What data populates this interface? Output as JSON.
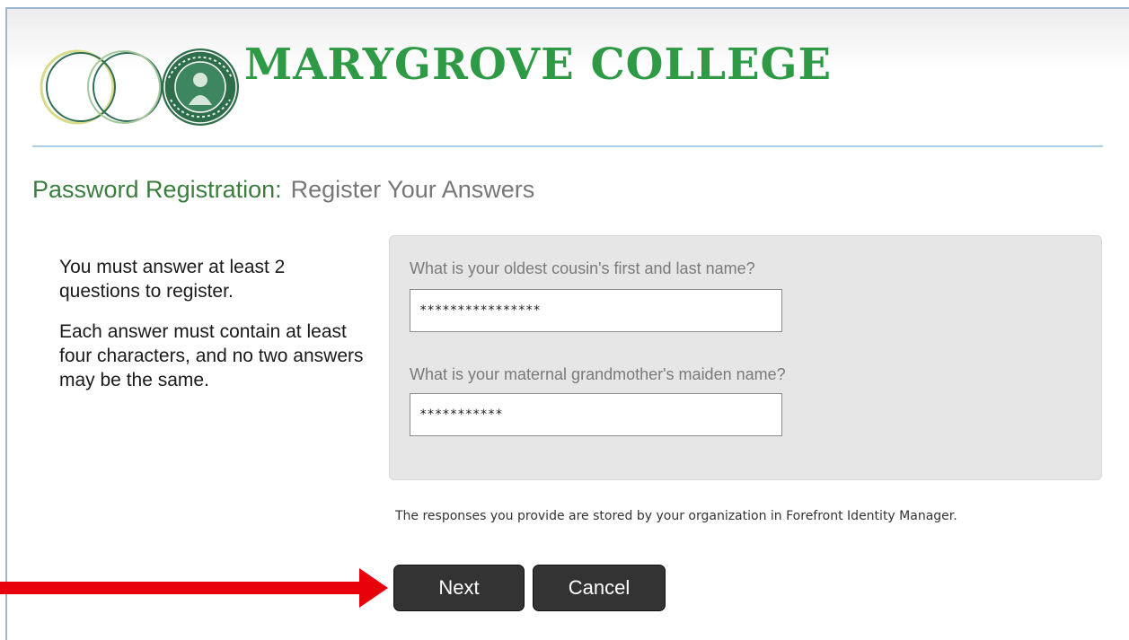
{
  "header": {
    "college_name": "MARYGROVE COLLEGE"
  },
  "page": {
    "title_main": "Password Registration:",
    "title_sub": "Register Your Answers"
  },
  "instructions": {
    "line1": "You must answer at least 2 questions to register.",
    "line2": "Each answer must contain at least four characters, and no two answers may be the same."
  },
  "questions": [
    {
      "label": "What is your oldest cousin's first and last name?",
      "value": "****************"
    },
    {
      "label": "What is your maternal grandmother's maiden name?",
      "value": "***********"
    }
  ],
  "note": "The responses you provide are stored by your organization in Forefront Identity Manager.",
  "buttons": {
    "next": "Next",
    "cancel": "Cancel"
  },
  "colors": {
    "brand_green": "#2e9a45",
    "title_green": "#3b7d3f",
    "button_dark": "#333333",
    "annotation_arrow": "#e8000b"
  },
  "icons": {
    "logo_rings": "interlocking-rings-icon",
    "logo_seal": "college-seal-icon",
    "annotation": "red-arrow-icon"
  }
}
